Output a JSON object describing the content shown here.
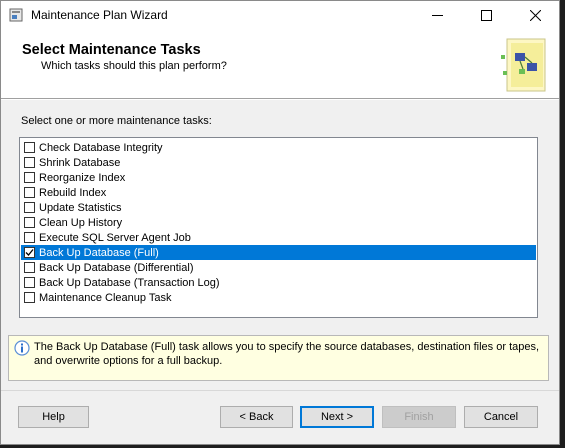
{
  "window": {
    "title": "Maintenance Plan Wizard",
    "controls": {
      "minimize": "minimize",
      "maximize": "maximize",
      "close": "close"
    }
  },
  "header": {
    "title": "Select Maintenance Tasks",
    "subtitle": "Which tasks should this plan perform?"
  },
  "instruction": "Select one or more maintenance tasks:",
  "tasks": [
    {
      "label": "Check Database Integrity",
      "checked": false,
      "selected": false
    },
    {
      "label": "Shrink Database",
      "checked": false,
      "selected": false
    },
    {
      "label": "Reorganize Index",
      "checked": false,
      "selected": false
    },
    {
      "label": "Rebuild Index",
      "checked": false,
      "selected": false
    },
    {
      "label": "Update Statistics",
      "checked": false,
      "selected": false
    },
    {
      "label": "Clean Up History",
      "checked": false,
      "selected": false
    },
    {
      "label": "Execute SQL Server Agent Job",
      "checked": false,
      "selected": false
    },
    {
      "label": "Back Up Database (Full)",
      "checked": true,
      "selected": true
    },
    {
      "label": "Back Up Database (Differential)",
      "checked": false,
      "selected": false
    },
    {
      "label": "Back Up Database (Transaction Log)",
      "checked": false,
      "selected": false
    },
    {
      "label": "Maintenance Cleanup Task",
      "checked": false,
      "selected": false
    }
  ],
  "info": {
    "text": "The Back Up Database (Full) task allows you to specify the source databases, destination files or tapes, and overwrite options for a full backup."
  },
  "buttons": {
    "help": "Help",
    "back": "< Back",
    "next": "Next >",
    "finish": "Finish",
    "cancel": "Cancel"
  },
  "colors": {
    "selection": "#0078d7",
    "info_bg": "#ffffe1"
  }
}
